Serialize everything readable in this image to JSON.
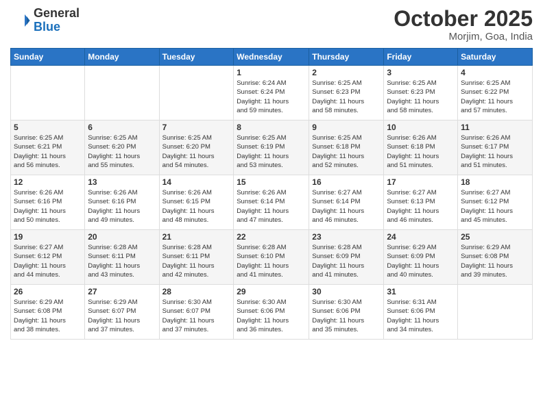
{
  "header": {
    "logo_general": "General",
    "logo_blue": "Blue",
    "month_title": "October 2025",
    "location": "Morjim, Goa, India"
  },
  "weekdays": [
    "Sunday",
    "Monday",
    "Tuesday",
    "Wednesday",
    "Thursday",
    "Friday",
    "Saturday"
  ],
  "weeks": [
    [
      {
        "day": "",
        "info": ""
      },
      {
        "day": "",
        "info": ""
      },
      {
        "day": "",
        "info": ""
      },
      {
        "day": "1",
        "info": "Sunrise: 6:24 AM\nSunset: 6:24 PM\nDaylight: 11 hours\nand 59 minutes."
      },
      {
        "day": "2",
        "info": "Sunrise: 6:25 AM\nSunset: 6:23 PM\nDaylight: 11 hours\nand 58 minutes."
      },
      {
        "day": "3",
        "info": "Sunrise: 6:25 AM\nSunset: 6:23 PM\nDaylight: 11 hours\nand 58 minutes."
      },
      {
        "day": "4",
        "info": "Sunrise: 6:25 AM\nSunset: 6:22 PM\nDaylight: 11 hours\nand 57 minutes."
      }
    ],
    [
      {
        "day": "5",
        "info": "Sunrise: 6:25 AM\nSunset: 6:21 PM\nDaylight: 11 hours\nand 56 minutes."
      },
      {
        "day": "6",
        "info": "Sunrise: 6:25 AM\nSunset: 6:20 PM\nDaylight: 11 hours\nand 55 minutes."
      },
      {
        "day": "7",
        "info": "Sunrise: 6:25 AM\nSunset: 6:20 PM\nDaylight: 11 hours\nand 54 minutes."
      },
      {
        "day": "8",
        "info": "Sunrise: 6:25 AM\nSunset: 6:19 PM\nDaylight: 11 hours\nand 53 minutes."
      },
      {
        "day": "9",
        "info": "Sunrise: 6:25 AM\nSunset: 6:18 PM\nDaylight: 11 hours\nand 52 minutes."
      },
      {
        "day": "10",
        "info": "Sunrise: 6:26 AM\nSunset: 6:18 PM\nDaylight: 11 hours\nand 51 minutes."
      },
      {
        "day": "11",
        "info": "Sunrise: 6:26 AM\nSunset: 6:17 PM\nDaylight: 11 hours\nand 51 minutes."
      }
    ],
    [
      {
        "day": "12",
        "info": "Sunrise: 6:26 AM\nSunset: 6:16 PM\nDaylight: 11 hours\nand 50 minutes."
      },
      {
        "day": "13",
        "info": "Sunrise: 6:26 AM\nSunset: 6:16 PM\nDaylight: 11 hours\nand 49 minutes."
      },
      {
        "day": "14",
        "info": "Sunrise: 6:26 AM\nSunset: 6:15 PM\nDaylight: 11 hours\nand 48 minutes."
      },
      {
        "day": "15",
        "info": "Sunrise: 6:26 AM\nSunset: 6:14 PM\nDaylight: 11 hours\nand 47 minutes."
      },
      {
        "day": "16",
        "info": "Sunrise: 6:27 AM\nSunset: 6:14 PM\nDaylight: 11 hours\nand 46 minutes."
      },
      {
        "day": "17",
        "info": "Sunrise: 6:27 AM\nSunset: 6:13 PM\nDaylight: 11 hours\nand 46 minutes."
      },
      {
        "day": "18",
        "info": "Sunrise: 6:27 AM\nSunset: 6:12 PM\nDaylight: 11 hours\nand 45 minutes."
      }
    ],
    [
      {
        "day": "19",
        "info": "Sunrise: 6:27 AM\nSunset: 6:12 PM\nDaylight: 11 hours\nand 44 minutes."
      },
      {
        "day": "20",
        "info": "Sunrise: 6:28 AM\nSunset: 6:11 PM\nDaylight: 11 hours\nand 43 minutes."
      },
      {
        "day": "21",
        "info": "Sunrise: 6:28 AM\nSunset: 6:11 PM\nDaylight: 11 hours\nand 42 minutes."
      },
      {
        "day": "22",
        "info": "Sunrise: 6:28 AM\nSunset: 6:10 PM\nDaylight: 11 hours\nand 41 minutes."
      },
      {
        "day": "23",
        "info": "Sunrise: 6:28 AM\nSunset: 6:09 PM\nDaylight: 11 hours\nand 41 minutes."
      },
      {
        "day": "24",
        "info": "Sunrise: 6:29 AM\nSunset: 6:09 PM\nDaylight: 11 hours\nand 40 minutes."
      },
      {
        "day": "25",
        "info": "Sunrise: 6:29 AM\nSunset: 6:08 PM\nDaylight: 11 hours\nand 39 minutes."
      }
    ],
    [
      {
        "day": "26",
        "info": "Sunrise: 6:29 AM\nSunset: 6:08 PM\nDaylight: 11 hours\nand 38 minutes."
      },
      {
        "day": "27",
        "info": "Sunrise: 6:29 AM\nSunset: 6:07 PM\nDaylight: 11 hours\nand 37 minutes."
      },
      {
        "day": "28",
        "info": "Sunrise: 6:30 AM\nSunset: 6:07 PM\nDaylight: 11 hours\nand 37 minutes."
      },
      {
        "day": "29",
        "info": "Sunrise: 6:30 AM\nSunset: 6:06 PM\nDaylight: 11 hours\nand 36 minutes."
      },
      {
        "day": "30",
        "info": "Sunrise: 6:30 AM\nSunset: 6:06 PM\nDaylight: 11 hours\nand 35 minutes."
      },
      {
        "day": "31",
        "info": "Sunrise: 6:31 AM\nSunset: 6:06 PM\nDaylight: 11 hours\nand 34 minutes."
      },
      {
        "day": "",
        "info": ""
      }
    ]
  ]
}
